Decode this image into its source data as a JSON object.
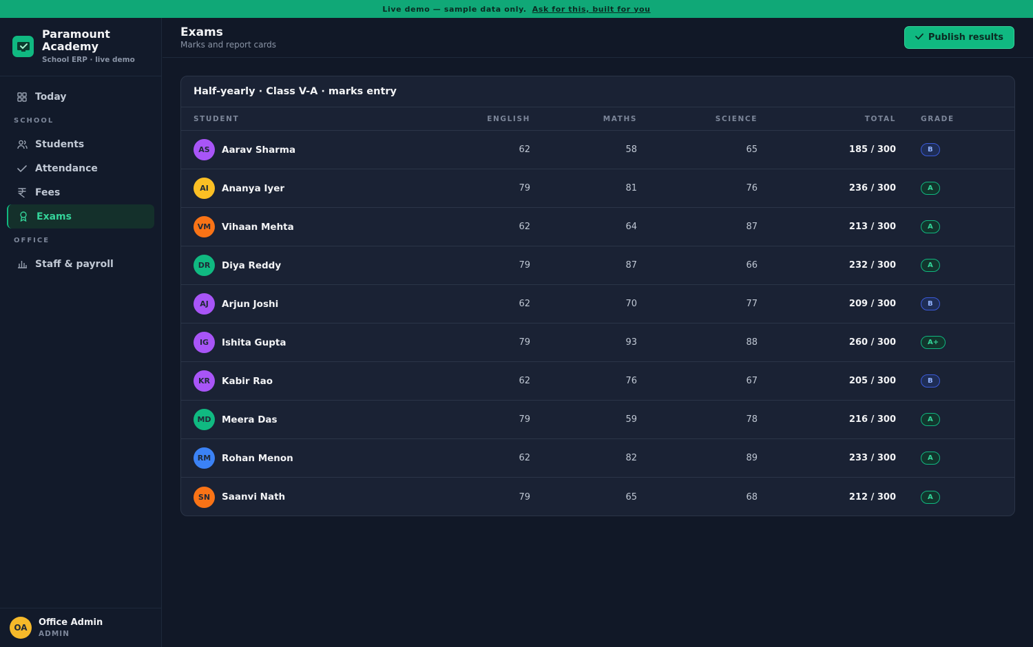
{
  "banner": {
    "text": "Live demo — sample data only.",
    "link": "Ask for this, built for you"
  },
  "brand": {
    "name": "Paramount Academy",
    "sub": "School ERP · live demo"
  },
  "nav": {
    "today": "Today",
    "section_school": "SCHOOL",
    "students": "Students",
    "attendance": "Attendance",
    "fees": "Fees",
    "exams": "Exams",
    "section_office": "OFFICE",
    "staff": "Staff & payroll"
  },
  "user": {
    "initials": "OA",
    "name": "Office Admin",
    "role": "ADMIN"
  },
  "header": {
    "title": "Exams",
    "subtitle": "Marks and report cards",
    "publish_label": "Publish results"
  },
  "table": {
    "title": "Half-yearly · Class V-A · marks entry",
    "columns": [
      "STUDENT",
      "ENGLISH",
      "MATHS",
      "SCIENCE",
      "TOTAL",
      "GRADE"
    ],
    "rows": [
      {
        "initials": "AS",
        "name": "Aarav Sharma",
        "english": "62",
        "maths": "58",
        "science": "65",
        "total": "185 / 300",
        "grade": "B",
        "avatar_color": "#a855f7"
      },
      {
        "initials": "AI",
        "name": "Ananya Iyer",
        "english": "79",
        "maths": "81",
        "science": "76",
        "total": "236 / 300",
        "grade": "A",
        "avatar_color": "#fbbf24"
      },
      {
        "initials": "VM",
        "name": "Vihaan Mehta",
        "english": "62",
        "maths": "64",
        "science": "87",
        "total": "213 / 300",
        "grade": "A",
        "avatar_color": "#f97316"
      },
      {
        "initials": "DR",
        "name": "Diya Reddy",
        "english": "79",
        "maths": "87",
        "science": "66",
        "total": "232 / 300",
        "grade": "A",
        "avatar_color": "#10b981"
      },
      {
        "initials": "AJ",
        "name": "Arjun Joshi",
        "english": "62",
        "maths": "70",
        "science": "77",
        "total": "209 / 300",
        "grade": "B",
        "avatar_color": "#a855f7"
      },
      {
        "initials": "IG",
        "name": "Ishita Gupta",
        "english": "79",
        "maths": "93",
        "science": "88",
        "total": "260 / 300",
        "grade": "A+",
        "avatar_color": "#a855f7"
      },
      {
        "initials": "KR",
        "name": "Kabir Rao",
        "english": "62",
        "maths": "76",
        "science": "67",
        "total": "205 / 300",
        "grade": "B",
        "avatar_color": "#a855f7"
      },
      {
        "initials": "MD",
        "name": "Meera Das",
        "english": "79",
        "maths": "59",
        "science": "78",
        "total": "216 / 300",
        "grade": "A",
        "avatar_color": "#10b981"
      },
      {
        "initials": "RM",
        "name": "Rohan Menon",
        "english": "62",
        "maths": "82",
        "science": "89",
        "total": "233 / 300",
        "grade": "A",
        "avatar_color": "#3b82f6"
      },
      {
        "initials": "SN",
        "name": "Saanvi Nath",
        "english": "79",
        "maths": "65",
        "science": "68",
        "total": "212 / 300",
        "grade": "A",
        "avatar_color": "#f97316"
      }
    ]
  }
}
